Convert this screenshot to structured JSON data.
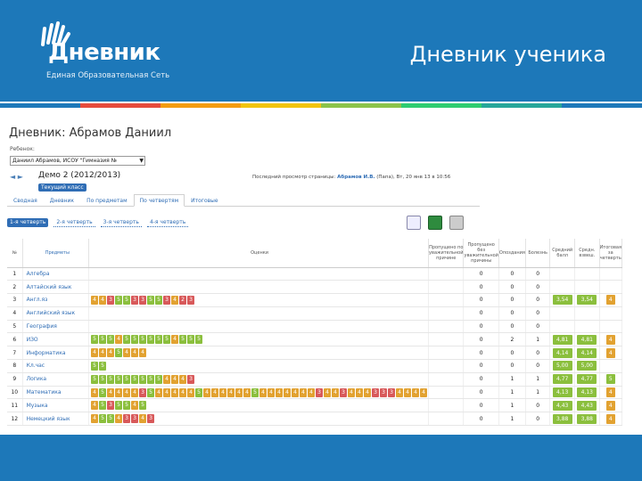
{
  "header": {
    "logo_word": "Дневник",
    "logo_subtitle": "Единая Образовательная Сеть",
    "slide_title": "Дневник ученика",
    "band_color": "#1d78b9"
  },
  "stripe_colors": [
    "#1d78b9",
    "#e64b3c",
    "#f39c12",
    "#f1c40f",
    "#8bc34a",
    "#2ecc71",
    "#26a69a",
    "#1d78b9"
  ],
  "page": {
    "title": "Дневник: Абрамов Даниил",
    "child_label": "Ребенок:",
    "child_value": "Даниил Абрамов, ИСОУ \"Гимназия №",
    "nav_arrows": "◄ ►",
    "school": "Демо 2 (2012/2013)",
    "class_badge": "Текущий класс",
    "last_page_prefix": "Последний просмотр страницы:",
    "last_page_user": "Абрамов И.В.",
    "last_page_suffix": "(Папа), Вт, 20 янв 13 в 10:56"
  },
  "tabs": [
    {
      "label": "Сводная",
      "active": false
    },
    {
      "label": "Дневник",
      "active": false
    },
    {
      "label": "По предметам",
      "active": false
    },
    {
      "label": "По четвертям",
      "active": true
    },
    {
      "label": "Итоговые",
      "active": false
    }
  ],
  "subtabs": [
    {
      "label": "1-я четверть",
      "active": true
    },
    {
      "label": "2-я четверть",
      "active": false
    },
    {
      "label": "3-я четверть",
      "active": false
    },
    {
      "label": "4-я четверть",
      "active": false
    }
  ],
  "toolbar_icons": [
    "chart-icon",
    "excel-icon",
    "print-icon"
  ],
  "table": {
    "headers": {
      "num": "№",
      "subject": "Предметы",
      "marks": "Оценки",
      "skips_reason": "Пропущено по уважительной причине",
      "skips_noreason": "Пропущено без уважительной причины",
      "late": "Опоздания",
      "sick": "Болезнь",
      "avg": "Средний балл",
      "weighted": "Средн. взвеш.",
      "final": "Итоговая за четверть"
    },
    "rows": [
      {
        "n": "1",
        "subject": "Алгебра",
        "marks": "",
        "s1": "0",
        "s2": "0",
        "s3": "0",
        "avg": "",
        "w": "",
        "fin": ""
      },
      {
        "n": "2",
        "subject": "Алтайский язык",
        "marks": "",
        "s1": "0",
        "s2": "0",
        "s3": "0",
        "avg": "",
        "w": "",
        "fin": ""
      },
      {
        "n": "3",
        "subject": "Англ.яз",
        "marks": "4 4 3 5 5 3 3 5 5 3 4 2 3",
        "s1": "0",
        "s2": "0",
        "s3": "0",
        "avg": "3,54",
        "w": "3,54",
        "fin": "4"
      },
      {
        "n": "4",
        "subject": "Английский язык",
        "marks": "",
        "s1": "0",
        "s2": "0",
        "s3": "0",
        "avg": "",
        "w": "",
        "fin": ""
      },
      {
        "n": "5",
        "subject": "География",
        "marks": "",
        "s1": "0",
        "s2": "0",
        "s3": "0",
        "avg": "",
        "w": "",
        "fin": ""
      },
      {
        "n": "6",
        "subject": "ИЗО",
        "marks": "5 5 5 4 5 5 5 5 5 5 4 5 5 5",
        "s1": "0",
        "s2": "2",
        "s3": "1",
        "avg": "4,81",
        "w": "4,81",
        "fin": "4"
      },
      {
        "n": "7",
        "subject": "Информатика",
        "marks": "4 4 4 5 4 4 4",
        "s1": "0",
        "s2": "0",
        "s3": "0",
        "avg": "4,14",
        "w": "4,14",
        "fin": "4"
      },
      {
        "n": "8",
        "subject": "Кл.час",
        "marks": "5 5",
        "s1": "0",
        "s2": "0",
        "s3": "0",
        "avg": "5,00",
        "w": "5,00",
        "fin": ""
      },
      {
        "n": "9",
        "subject": "Логика",
        "marks": "5 5 5 5 5 5 5 5 5 4 4 4 3",
        "s1": "0",
        "s2": "1",
        "s3": "1",
        "avg": "4,77",
        "w": "4,77",
        "fin": "5"
      },
      {
        "n": "10",
        "subject": "Математика",
        "marks": "4 5 4 4 4 4 3 5 4 4 4 4 4 5 4 4 4 4 4 4 5 4 4 4 4 4 4 4 3 4 4 3 4 4 4 3 3 3 4 4 4 4",
        "s1": "0",
        "s2": "1",
        "s3": "1",
        "avg": "4,13",
        "w": "4,13",
        "fin": "4"
      },
      {
        "n": "11",
        "subject": "Музыка",
        "marks": "4 5 3 5 5 4 5",
        "s1": "0",
        "s2": "1",
        "s3": "0",
        "avg": "4,43",
        "w": "4,43",
        "fin": "4"
      },
      {
        "n": "12",
        "subject": "Немецкий язык",
        "marks": "4 5 5 4 3 3 4 3",
        "s1": "0",
        "s2": "1",
        "s3": "0",
        "avg": "3,88",
        "w": "3,88",
        "fin": "4"
      }
    ]
  }
}
